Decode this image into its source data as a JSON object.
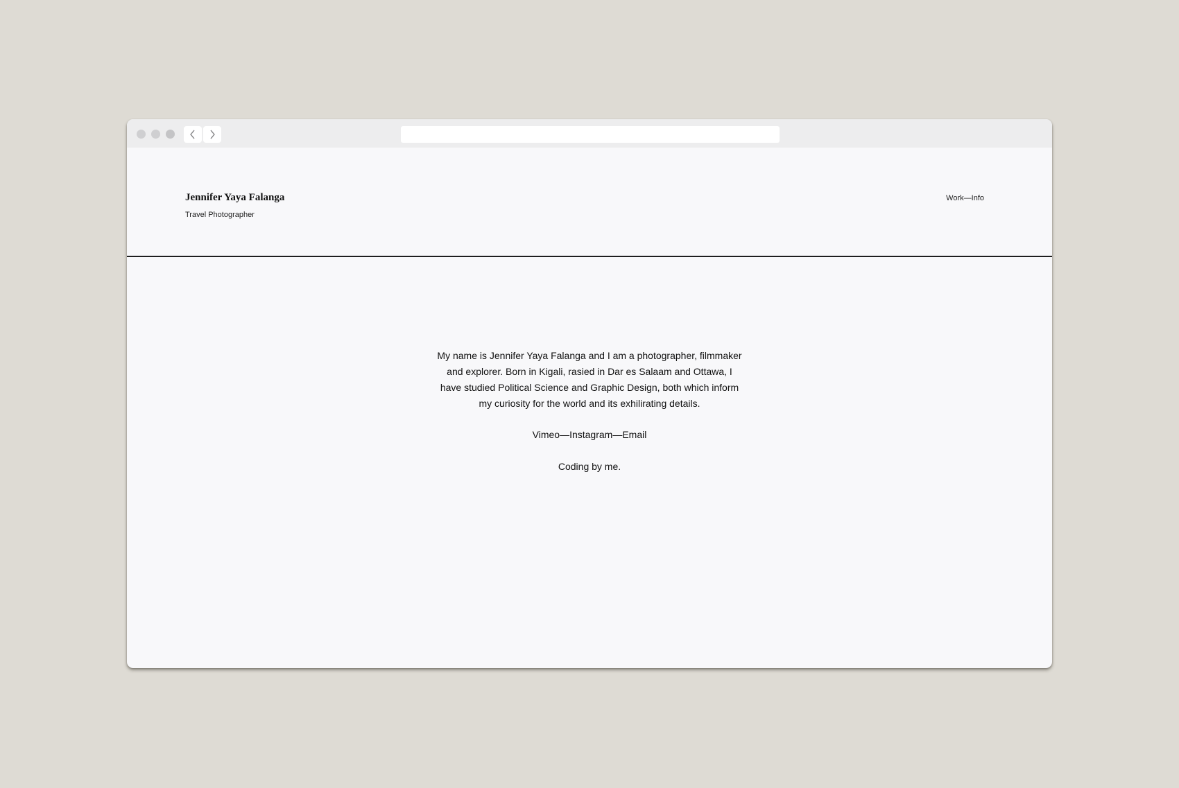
{
  "site": {
    "title": "Jennifer Yaya Falanga",
    "subtitle": "Travel Photographer"
  },
  "nav": {
    "work": "Work",
    "separator": "—",
    "info": "Info"
  },
  "bio": {
    "text": "My name is Jennifer Yaya Falanga and I am a photographer, filmmaker and explorer. Born in Kigali, rasied in Dar es Salaam and Ottawa, I have studied Political Science and Graphic Design, both which inform my curiosity for the world and its exhilirating details."
  },
  "links": {
    "vimeo": "Vimeo",
    "instagram": "Instagram",
    "email": "Email",
    "separator": "—"
  },
  "footer": {
    "credit": "Coding by me."
  },
  "colors": {
    "backdrop": "#dedbd4",
    "page": "#f8f8fa",
    "titlebar": "#ededee",
    "text": "#111111",
    "rule": "#1e1e1e"
  },
  "icons": {
    "back": "chevron-left-icon",
    "forward": "chevron-right-icon"
  }
}
